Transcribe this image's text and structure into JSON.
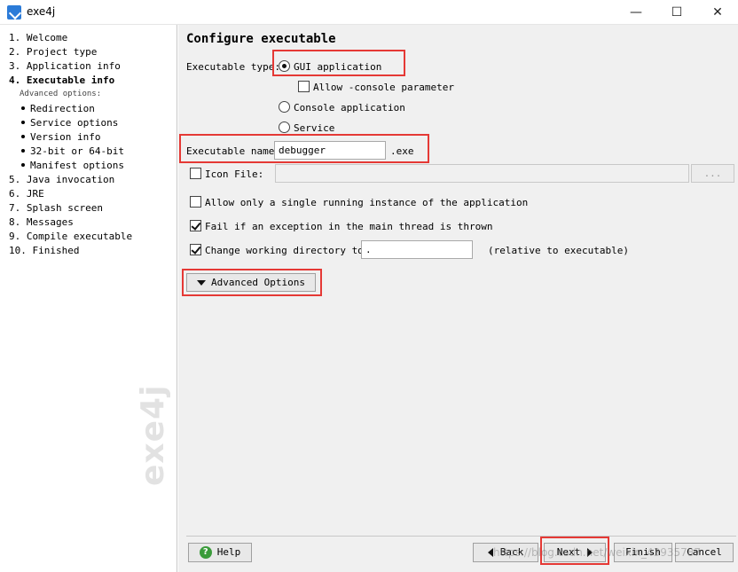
{
  "window": {
    "title": "exe4j",
    "minimize": "—",
    "maximize": "☐",
    "close": "✕"
  },
  "sidebar": {
    "steps": [
      {
        "label": "1. Welcome"
      },
      {
        "label": "2. Project type"
      },
      {
        "label": "3. Application info"
      },
      {
        "label": "4. Executable info"
      },
      {
        "label": "5. Java invocation"
      },
      {
        "label": "6. JRE"
      },
      {
        "label": "7. Splash screen"
      },
      {
        "label": "8. Messages"
      },
      {
        "label": "9. Compile executable"
      },
      {
        "label": "10. Finished"
      }
    ],
    "advanced_heading": "Advanced options:",
    "sub_steps": [
      "Redirection",
      "Service options",
      "Version info",
      "32-bit or 64-bit",
      "Manifest options"
    ],
    "brand": "exe4j"
  },
  "main": {
    "title": "Configure executable",
    "executable_type_label": "Executable type:",
    "gui_app": "GUI application",
    "allow_console": "Allow -console parameter",
    "console_app": "Console application",
    "service": "Service",
    "executable_name_label": "Executable name:",
    "executable_name_value": "debugger",
    "exe_suffix": ".exe",
    "icon_file_label": "Icon File:",
    "icon_file_value": "",
    "browse_label": "...",
    "single_instance": "Allow only a single running instance of the application",
    "fail_exception": "Fail if an exception in the main thread is thrown",
    "change_dir": "Change working directory to:",
    "change_dir_value": ".",
    "relative_note": "(relative to executable)",
    "advanced_options": "Advanced Options"
  },
  "footer": {
    "help": "Help",
    "back": "Back",
    "next": "Next",
    "finish": "Finish",
    "cancel": "Cancel",
    "watermark": "https://blog.csdn.net/weixin_43935787"
  },
  "colors": {
    "highlight": "#e53935",
    "panel_bg": "#f0f0f0"
  }
}
